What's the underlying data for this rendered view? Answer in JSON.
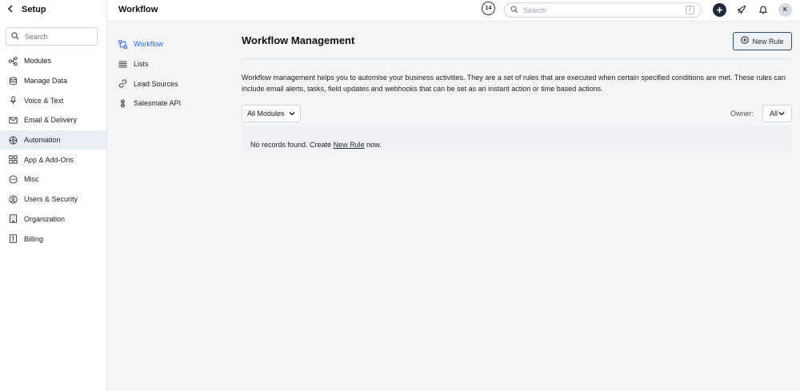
{
  "sidebar": {
    "title": "Setup",
    "search_placeholder": "Search",
    "items": [
      {
        "label": "Modules",
        "icon": "modules-icon"
      },
      {
        "label": "Manage Data",
        "icon": "database-icon"
      },
      {
        "label": "Voice & Text",
        "icon": "microphone-icon"
      },
      {
        "label": "Email & Delivery",
        "icon": "mail-icon"
      },
      {
        "label": "Automation",
        "icon": "automation-icon",
        "active": true
      },
      {
        "label": "App & Add-Ons",
        "icon": "apps-icon"
      },
      {
        "label": "Misc",
        "icon": "dots-icon"
      },
      {
        "label": "Users & Security",
        "icon": "user-icon"
      },
      {
        "label": "Organization",
        "icon": "building-icon"
      },
      {
        "label": "Billing",
        "icon": "billing-icon"
      }
    ]
  },
  "topbar": {
    "title": "Workflow",
    "badge_count": "14",
    "search_placeholder": "Search",
    "search_shortcut": "/",
    "avatar_initial": "K"
  },
  "subnav": {
    "items": [
      {
        "label": "Workflow",
        "icon": "workflow-icon",
        "active": true
      },
      {
        "label": "Lists",
        "icon": "list-icon"
      },
      {
        "label": "Lead Sources",
        "icon": "link-icon"
      },
      {
        "label": "Salesmate API",
        "icon": "api-icon"
      }
    ]
  },
  "main": {
    "title": "Workflow Management",
    "new_rule_label": "New Rule",
    "description": "Workflow management helps you to automise your business activities. They are a set of rules that are executed when certain specified conditions are met. These rules can include email alerts, tasks, field updates and webhooks that can be set as an instant action or time based actions.",
    "modules_filter": "All Modules",
    "owner_label": "Owner:",
    "owner_value": "All",
    "empty_prefix": "No records found. Create ",
    "empty_link": "New Rule",
    "empty_suffix": " now."
  },
  "colors": {
    "accent": "#2563eb",
    "active_bg": "#e9eef6",
    "button_border": "#2f4d6f"
  }
}
